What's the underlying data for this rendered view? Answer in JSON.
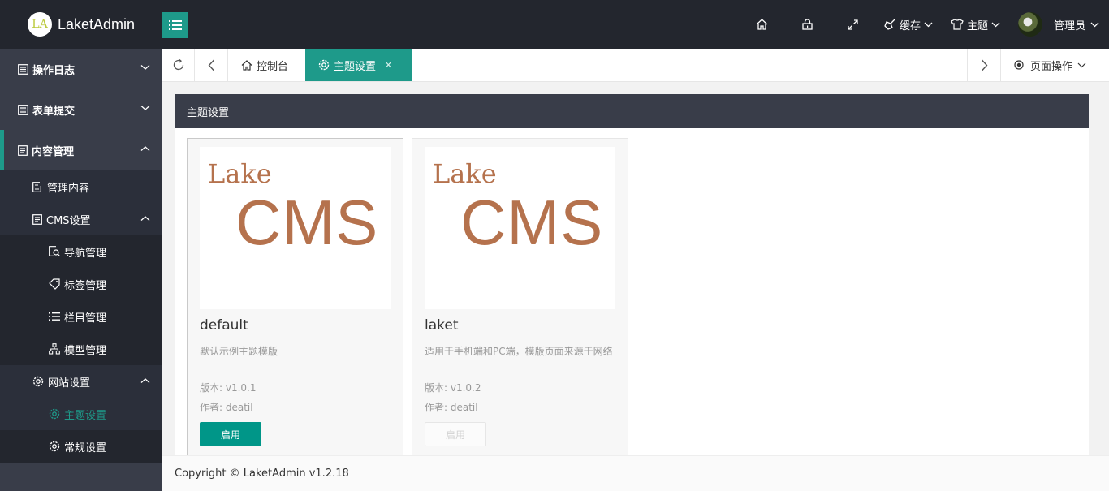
{
  "app": {
    "logo_badge": "LA",
    "title": "LaketAdmin"
  },
  "header": {
    "items": [
      {
        "icon": "home-icon"
      },
      {
        "icon": "lock-icon"
      },
      {
        "icon": "fullscreen-icon"
      },
      {
        "icon": "broom-icon",
        "label": "缓存"
      },
      {
        "icon": "tshirt-icon",
        "label": "主题"
      },
      {
        "icon": "avatar",
        "label": "管理员"
      }
    ]
  },
  "sidebar": {
    "groups": [
      {
        "label": "操作日志",
        "icon": "list-icon",
        "expanded": false
      },
      {
        "label": "表单提交",
        "icon": "list-icon",
        "expanded": false
      },
      {
        "label": "内容管理",
        "icon": "document-icon",
        "expanded": true
      }
    ],
    "content_items": [
      {
        "label": "管理内容",
        "icon": "edit-doc-icon"
      },
      {
        "label": "CMS设置",
        "icon": "document-icon",
        "expanded": true
      }
    ],
    "cms_items": [
      {
        "label": "导航管理",
        "icon": "search-doc-icon"
      },
      {
        "label": "标签管理",
        "icon": "tag-icon"
      },
      {
        "label": "栏目管理",
        "icon": "list-bullets-icon"
      },
      {
        "label": "模型管理",
        "icon": "sitemap-icon"
      }
    ],
    "site_group": {
      "label": "网站设置",
      "icon": "gear-icon",
      "expanded": true
    },
    "site_items": [
      {
        "label": "主题设置",
        "icon": "gear-icon",
        "selected": true
      },
      {
        "label": "常规设置",
        "icon": "gear-icon",
        "selected": false
      }
    ]
  },
  "tabs": [
    {
      "label": "控制台",
      "icon": "home-icon",
      "active": false
    },
    {
      "label": "主题设置",
      "icon": "gear-icon",
      "active": true,
      "close": "×"
    }
  ],
  "page_ops": {
    "label": "页面操作"
  },
  "panel": {
    "title": "主题设置",
    "themes": [
      {
        "thumb_line1": "Lake",
        "thumb_line2": "CMS",
        "name": "default",
        "desc": "默认示例主题模版",
        "version": "版本: v1.0.1",
        "author": "作者: deatil",
        "button": "启用",
        "enabled_button": true
      },
      {
        "thumb_line1": "Lake",
        "thumb_line2": "CMS",
        "name": "laket",
        "desc": "适用于手机端和PC端，模版页面来源于网络",
        "version": "版本: v1.0.2",
        "author": "作者: deatil",
        "button": "启用",
        "enabled_button": false
      }
    ]
  },
  "footer": {
    "copyright": "Copyright © LaketAdmin v1.2.18"
  },
  "colors": {
    "accent": "#1e9a8a",
    "header_bg": "#23262e",
    "sidebar_bg": "#393d49",
    "thumb_text": "#b5724d"
  }
}
